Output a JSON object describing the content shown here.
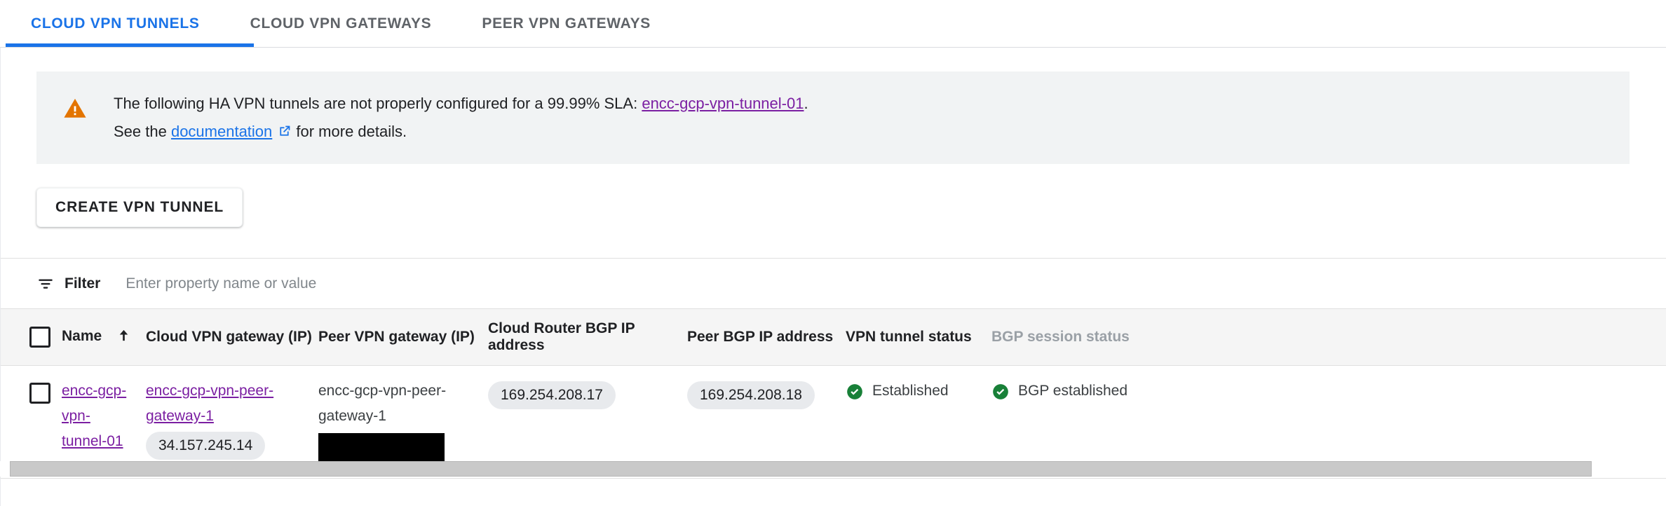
{
  "tabs": [
    {
      "label": "CLOUD VPN TUNNELS",
      "active": true
    },
    {
      "label": "CLOUD VPN GATEWAYS",
      "active": false
    },
    {
      "label": "PEER VPN GATEWAYS",
      "active": false
    }
  ],
  "banner": {
    "icon": "warning-triangle-icon",
    "icon_color": "#e37400",
    "line1_prefix": "The following HA VPN tunnels are not properly configured for a 99.99% SLA: ",
    "line1_link": "encc-gcp-vpn-tunnel-01",
    "line1_suffix": ".",
    "line2_prefix": "See the ",
    "line2_link": "documentation",
    "line2_icon": "external-link-icon",
    "line2_suffix": " for more details.",
    "bg_color": "#f1f3f4"
  },
  "toolbar": {
    "create_label": "CREATE VPN TUNNEL"
  },
  "filter": {
    "icon": "filter-icon",
    "label": "Filter",
    "placeholder": "Enter property name or value",
    "value": ""
  },
  "table": {
    "columns": [
      {
        "key": "check",
        "label": "",
        "muted": false
      },
      {
        "key": "name",
        "label": "Name",
        "muted": false,
        "sort": "ascending"
      },
      {
        "key": "cgw",
        "label": "Cloud VPN gateway (IP)",
        "muted": false
      },
      {
        "key": "pgw",
        "label": "Peer VPN gateway (IP)",
        "muted": false
      },
      {
        "key": "crbgp",
        "label": "Cloud Router BGP IP address",
        "muted": false
      },
      {
        "key": "pbgp",
        "label": "Peer BGP IP address",
        "muted": false
      },
      {
        "key": "tstat",
        "label": "VPN tunnel status",
        "muted": false
      },
      {
        "key": "bstat",
        "label": "BGP session status",
        "muted": true
      }
    ],
    "rows": [
      {
        "checked": false,
        "name": "encc-gcp-vpn-tunnel-01",
        "cloud_vpn_gateway": "encc-gcp-vpn-peer-gateway-1",
        "cloud_vpn_gateway_ip": "34.157.245.14",
        "peer_vpn_gateway": "encc-gcp-vpn-peer-gateway-1",
        "peer_vpn_gateway_ip": "",
        "peer_vpn_gateway_ip_redacted": true,
        "cloud_router_bgp_ip": "169.254.208.17",
        "peer_bgp_ip": "169.254.208.18",
        "tunnel_status": "Established",
        "tunnel_status_icon": "check-circle-icon",
        "bgp_status": "BGP established",
        "bgp_status_icon": "check-circle-icon"
      }
    ]
  },
  "colors": {
    "accent_blue": "#1a73e8",
    "link_purple": "#7b1fa2",
    "warning_orange": "#e37400",
    "success_green": "#188038",
    "header_bg": "#f5f5f5",
    "chip_bg": "#e8eaed"
  },
  "scrollbar": {
    "orientation": "horizontal"
  }
}
